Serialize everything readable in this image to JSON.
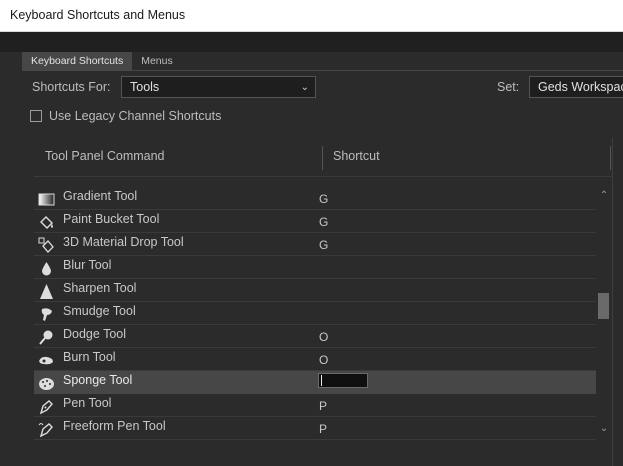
{
  "window": {
    "title": "Keyboard Shortcuts and Menus"
  },
  "tabs": [
    {
      "label": "Keyboard Shortcuts",
      "active": true
    },
    {
      "label": "Menus",
      "active": false
    }
  ],
  "controls": {
    "shortcuts_for_label": "Shortcuts For:",
    "shortcuts_for_value": "Tools",
    "set_label": "Set:",
    "set_value": "Geds Workspac",
    "legacy_label": "Use Legacy Channel Shortcuts",
    "legacy_checked": false
  },
  "table": {
    "columns": [
      "Tool Panel Command",
      "Shortcut"
    ],
    "rows": [
      {
        "icon": "gradient-tool-icon",
        "name": "Gradient Tool",
        "shortcut": "G"
      },
      {
        "icon": "paint-bucket-tool-icon",
        "name": "Paint Bucket Tool",
        "shortcut": "G"
      },
      {
        "icon": "3d-material-drop-tool-icon",
        "name": "3D Material Drop Tool",
        "shortcut": "G"
      },
      {
        "icon": "blur-tool-icon",
        "name": "Blur Tool",
        "shortcut": ""
      },
      {
        "icon": "sharpen-tool-icon",
        "name": "Sharpen Tool",
        "shortcut": ""
      },
      {
        "icon": "smudge-tool-icon",
        "name": "Smudge Tool",
        "shortcut": ""
      },
      {
        "icon": "dodge-tool-icon",
        "name": "Dodge Tool",
        "shortcut": "O"
      },
      {
        "icon": "burn-tool-icon",
        "name": "Burn Tool",
        "shortcut": "O"
      },
      {
        "icon": "sponge-tool-icon",
        "name": "Sponge Tool",
        "shortcut": "",
        "selected": true,
        "editing": true
      },
      {
        "icon": "pen-tool-icon",
        "name": "Pen Tool",
        "shortcut": "P"
      },
      {
        "icon": "freeform-pen-tool-icon",
        "name": "Freeform Pen Tool",
        "shortcut": "P"
      }
    ]
  },
  "colors": {
    "panel_bg": "#2b2b2b",
    "selected_row": "#474747",
    "text": "#c8c8c8"
  }
}
